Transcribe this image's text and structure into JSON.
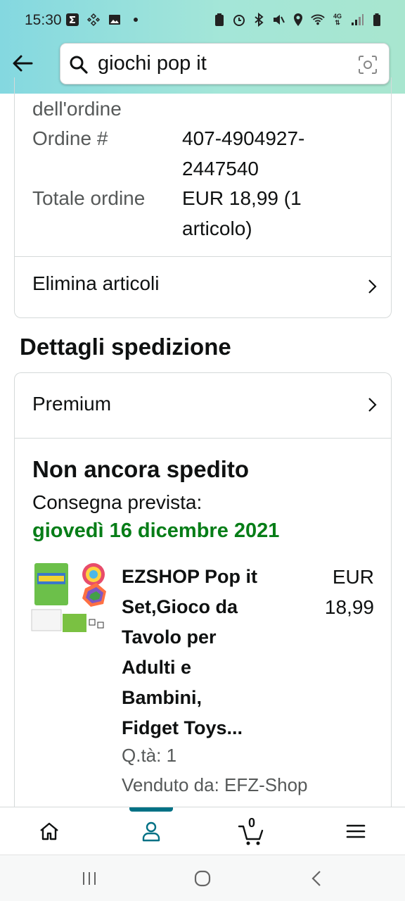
{
  "status_bar": {
    "time": "15:30",
    "network_label": "4G"
  },
  "search": {
    "query": "giochi pop it"
  },
  "order_summary": {
    "partial_label": "dell'ordine",
    "order_number_label": "Ordine #",
    "order_number_value_line1": "407-4904927-",
    "order_number_value_line2": "2447540",
    "total_label": "Totale ordine",
    "total_value_line1": "EUR 18,99 (1",
    "total_value_line2": "articolo)",
    "delete_items_label": "Elimina articoli"
  },
  "shipping": {
    "section_title": "Dettagli spedizione",
    "shipping_method": "Premium",
    "status_title": "Non ancora spedito",
    "eta_label": "Consegna prevista:",
    "eta_date": "giovedì 16 dicembre 2021",
    "product": {
      "title_lines": [
        "EZSHOP Pop it",
        "Set,Gioco da",
        "Tavolo per",
        "Adulti e",
        "Bambini,",
        "Fidget Toys..."
      ],
      "price_line1": "EUR",
      "price_line2": "18,99",
      "quantity": "Q.tà: 1",
      "seller": "Venduto da: EFZ-Shop"
    }
  },
  "bottom_nav": {
    "cart_count": "0"
  },
  "colors": {
    "accent": "#007185",
    "delivery_green": "#067d17",
    "header_start": "#84d8e0",
    "header_end": "#a8e6cf"
  }
}
